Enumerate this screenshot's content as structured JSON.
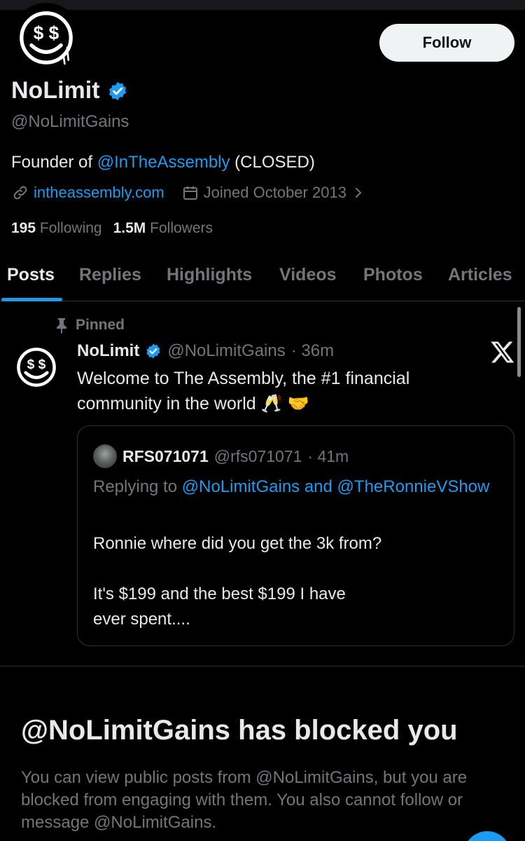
{
  "colors": {
    "accent": "#1d9bf0",
    "background": "#000000",
    "muted": "#71767b",
    "text": "#e7e9ea"
  },
  "profile": {
    "follow_label": "Follow",
    "display_name": "NoLimit",
    "handle": "@NoLimitGains",
    "bio_prefix": "Founder of ",
    "bio_mention": "@InTheAssembly",
    "bio_suffix": " (CLOSED)",
    "website": "intheassembly.com",
    "joined": "Joined October 2013",
    "following_count": "195",
    "following_label": "Following",
    "followers_count": "1.5M",
    "followers_label": "Followers",
    "avatar_glyph": "$ $",
    "icons": [
      "link-icon",
      "calendar-icon",
      "chevron-right-icon",
      "verified-badge-icon"
    ]
  },
  "tabs": [
    {
      "label": "Posts",
      "active": true
    },
    {
      "label": "Replies",
      "active": false
    },
    {
      "label": "Highlights",
      "active": false
    },
    {
      "label": "Videos",
      "active": false
    },
    {
      "label": "Photos",
      "active": false
    },
    {
      "label": "Articles",
      "active": false
    }
  ],
  "pinned_post": {
    "pinned_label": "Pinned",
    "author_name": "NoLimit",
    "author_handle": "@NoLimitGains",
    "time": "· 36m",
    "text": "Welcome to The Assembly, the #1 financial community in the world 🥂 🤝",
    "icons": [
      "pin-icon",
      "x-logo-icon"
    ],
    "quote": {
      "author_name": "RFS071071",
      "author_handle": "@rfs071071",
      "time": "· 41m",
      "replying_prefix": "Replying to ",
      "replying_to": "@NoLimitGains and @TheRonnieVShow",
      "body": "Ronnie where did you get the 3k from?\n\nIt's $199 and the best $199 I have\n ever spent...."
    }
  },
  "blocked": {
    "title": "@NoLimitGains has blocked you",
    "description": "You can view public posts from @NoLimitGains, but you are blocked from engaging with them. You also cannot follow or message @NoLimitGains."
  }
}
